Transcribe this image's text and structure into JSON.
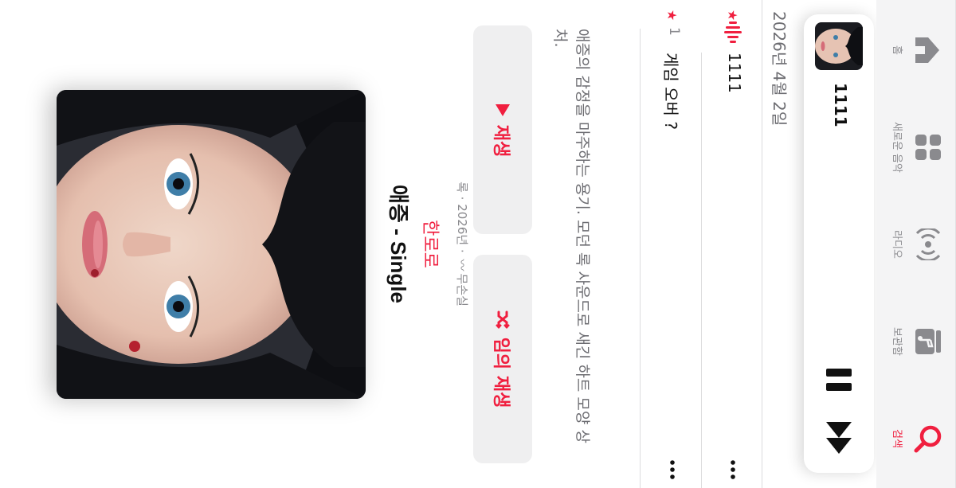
{
  "header": {
    "back_icon": "chevron-down-icon",
    "actions": [
      {
        "name": "add-icon",
        "glyph": "+"
      },
      {
        "name": "more-icon",
        "glyph": "•••"
      }
    ]
  },
  "album": {
    "title": "애증 - Single",
    "artist": "한로로",
    "genre": "록",
    "year": "2026년",
    "quality": "무손실",
    "description": "애증의 감정을 마주하는 용기. 모던 록 사운드로 새긴 하트 모양 상처."
  },
  "buttons": {
    "play_label": "재생",
    "shuffle_label": "임의 재생"
  },
  "tracks": [
    {
      "number": "1",
      "title": "게임 오버 ?",
      "favorite": true,
      "playing": false
    },
    {
      "number": "",
      "title": "1111",
      "favorite": true,
      "playing": true
    }
  ],
  "release_date": "2026년 4월 2일",
  "now_playing": {
    "title": "1111"
  },
  "tabs": [
    {
      "label": "홈",
      "icon": "home-icon",
      "active": false
    },
    {
      "label": "새로운 음악",
      "icon": "grid-icon",
      "active": false
    },
    {
      "label": "라디오",
      "icon": "radio-icon",
      "active": false
    },
    {
      "label": "보관함",
      "icon": "library-icon",
      "active": false
    },
    {
      "label": "검색",
      "icon": "search-icon",
      "active": true
    }
  ],
  "colors": {
    "accent": "#f01f3f",
    "secondary_text": "#8a8a8e",
    "button_bg": "#efeff0"
  }
}
